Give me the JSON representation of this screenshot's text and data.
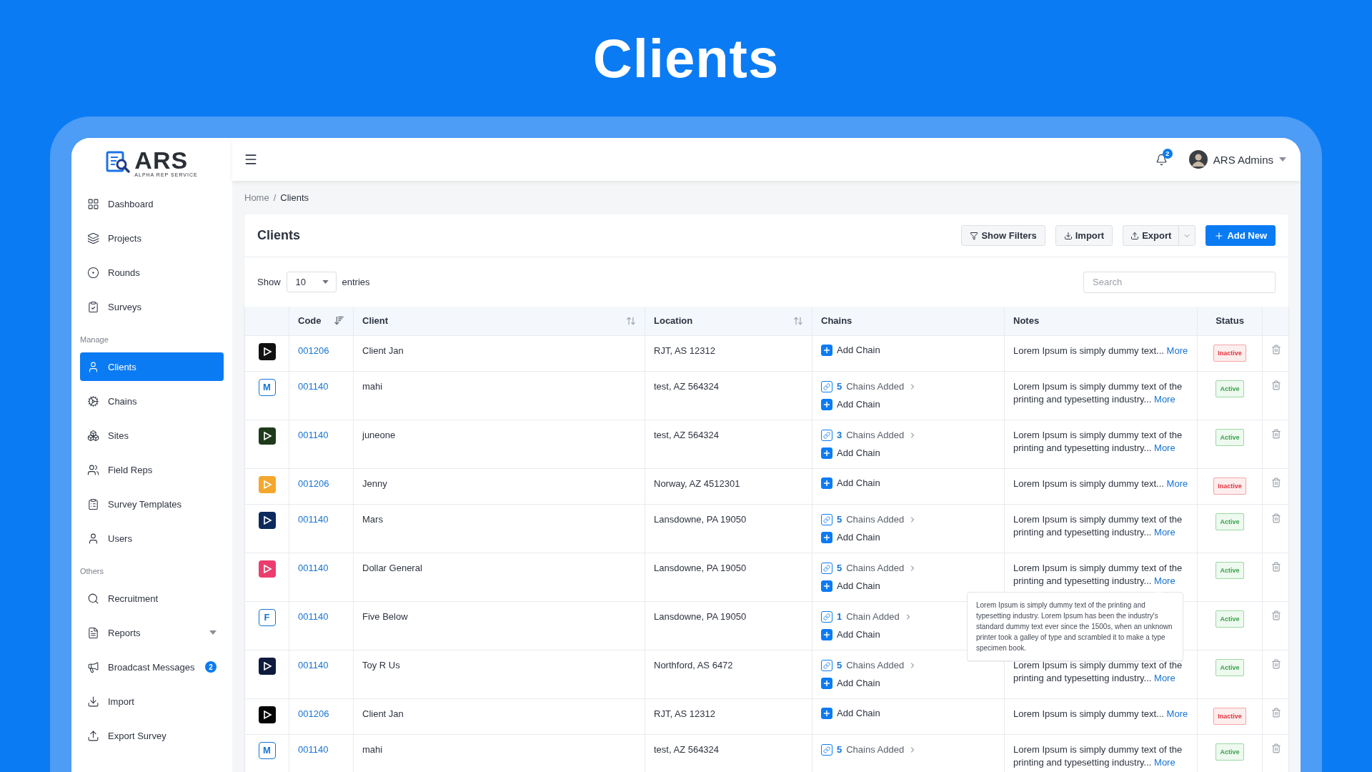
{
  "hero_title": "Clients",
  "brand": {
    "name": "ARS",
    "tagline": "ALPHA REP SERVICE"
  },
  "sidebar": {
    "sections": [
      {
        "items": [
          {
            "label": "Dashboard",
            "selected": false
          },
          {
            "label": "Projects",
            "selected": false
          },
          {
            "label": "Rounds",
            "selected": false
          },
          {
            "label": "Surveys",
            "selected": false
          }
        ]
      },
      {
        "heading": "Manage",
        "items": [
          {
            "label": "Clients",
            "selected": true
          },
          {
            "label": "Chains",
            "selected": false
          },
          {
            "label": "Sites",
            "selected": false
          },
          {
            "label": "Field Reps",
            "selected": false
          },
          {
            "label": "Survey Templates",
            "selected": false
          },
          {
            "label": "Users",
            "selected": false
          }
        ]
      },
      {
        "heading": "Others",
        "items": [
          {
            "label": "Recruitment",
            "selected": false
          },
          {
            "label": "Reports",
            "selected": false,
            "expanded": false
          },
          {
            "label": "Broadcast Messages",
            "selected": false,
            "badge": "2"
          },
          {
            "label": "Import",
            "selected": false
          },
          {
            "label": "Export Survey",
            "selected": false
          }
        ]
      }
    ]
  },
  "topbar": {
    "notifications": "2",
    "user": "ARS Admins"
  },
  "breadcrumb": {
    "separator": "/",
    "items": [
      "Home",
      "Clients"
    ]
  },
  "card": {
    "title": "Clients",
    "buttons": [
      {
        "label": "Show Filters",
        "kind": "filter"
      },
      {
        "label": "Import",
        "kind": "import"
      },
      {
        "label": "Export",
        "kind": "export"
      },
      {
        "label": "Add New",
        "kind": "add"
      }
    ],
    "length_menu": {
      "before": "Show",
      "value": "10",
      "after": "entries"
    },
    "search": {
      "placeholder": "Search"
    }
  },
  "table": {
    "columns": [
      {
        "label": "Code",
        "sortable": true,
        "sorted": true
      },
      {
        "label": "Client",
        "sortable": true,
        "sorted": false
      },
      {
        "label": "Location",
        "sortable": true,
        "sorted": false
      },
      {
        "label": "Chains",
        "sortable": false,
        "sorted": false
      },
      {
        "label": "Notes",
        "sortable": false,
        "sorted": false
      },
      {
        "label": "Status",
        "sortable": false,
        "sorted": false
      }
    ],
    "rows": [
      {
        "logo": {
          "kind": "image",
          "color": "#111111"
        },
        "code": "001206",
        "client": "Client Jan",
        "location": "RJT, AS 12312",
        "add_chain": "Add Chain",
        "note": "Lorem Ipsum is simply dummy text...",
        "more": "More",
        "status": "Inactive",
        "active": false
      },
      {
        "logo": {
          "kind": "letter",
          "letter": "M"
        },
        "code": "001140",
        "client": "mahi",
        "location": "test, AZ 564324",
        "chains_count": "5",
        "chains_label": "Chains Added",
        "add_chain": "Add Chain",
        "note": "Lorem Ipsum is simply dummy text of the printing and typesetting industry...",
        "more": "More",
        "status": "Active",
        "active": true
      },
      {
        "logo": {
          "kind": "image",
          "color": "#1f3a1a"
        },
        "code": "001140",
        "client": "juneone",
        "location": "test, AZ 564324",
        "chains_count": "3",
        "chains_label": "Chains Added",
        "add_chain": "Add Chain",
        "note": "Lorem Ipsum is simply dummy text of the printing and typesetting industry...",
        "more": "More",
        "status": "Active",
        "active": true
      },
      {
        "logo": {
          "kind": "image",
          "color": "#f3a72c"
        },
        "code": "001206",
        "client": "Jenny",
        "location": "Norway, AZ 4512301",
        "add_chain": "Add Chain",
        "note": "Lorem Ipsum is simply dummy text...",
        "more": "More",
        "status": "Inactive",
        "active": false
      },
      {
        "logo": {
          "kind": "image",
          "color": "#0d2a5c"
        },
        "code": "001140",
        "client": "Mars",
        "location": "Lansdowne, PA 19050",
        "chains_count": "5",
        "chains_label": "Chains Added",
        "add_chain": "Add Chain",
        "note": "Lorem Ipsum is simply dummy text of the printing and typesetting industry...",
        "more": "More",
        "status": "Active",
        "active": true
      },
      {
        "logo": {
          "kind": "image",
          "color": "#ec3d6f"
        },
        "code": "001140",
        "client": "Dollar General",
        "location": "Lansdowne, PA 19050",
        "chains_count": "5",
        "chains_label": "Chains Added",
        "add_chain": "Add Chain",
        "note": "Lorem Ipsum is simply dummy text of the printing and typesetting industry...",
        "more": "More",
        "status": "Active",
        "active": true,
        "tooltip": "Lorem Ipsum is simply dummy text of the printing and typesetting industry. Lorem Ipsum has been the industry's standard dummy text ever since the 1500s, when an unknown printer took a galley of type and scrambled it to make a type specimen book."
      },
      {
        "logo": {
          "kind": "letter",
          "letter": "F"
        },
        "code": "001140",
        "client": "Five Below",
        "location": "Lansdowne, PA 19050",
        "chains_count": "1",
        "chains_label": "Chain Added",
        "add_chain": "Add Chain",
        "status": "Active",
        "active": true
      },
      {
        "logo": {
          "kind": "image",
          "color": "#0f1b3d"
        },
        "code": "001140",
        "client": "Toy R Us",
        "location": "Northford, AS 6472",
        "chains_count": "5",
        "chains_label": "Chains Added",
        "add_chain": "Add Chain",
        "note": "Lorem Ipsum is simply dummy text of the printing and typesetting industry...",
        "more": "More",
        "status": "Active",
        "active": true
      },
      {
        "logo": {
          "kind": "image",
          "color": "#050505"
        },
        "code": "001206",
        "client": "Client Jan",
        "location": "RJT, AS 12312",
        "add_chain": "Add Chain",
        "note": "Lorem Ipsum is simply dummy text...",
        "more": "More",
        "status": "Inactive",
        "active": false
      },
      {
        "logo": {
          "kind": "letter",
          "letter": "M"
        },
        "code": "001140",
        "client": "mahi",
        "location": "test, AZ 564324",
        "chains_count": "5",
        "chains_label": "Chains Added",
        "note": "Lorem Ipsum is simply dummy text of the printing and typesetting industry...",
        "more": "More",
        "status": "Active",
        "active": true
      }
    ]
  }
}
